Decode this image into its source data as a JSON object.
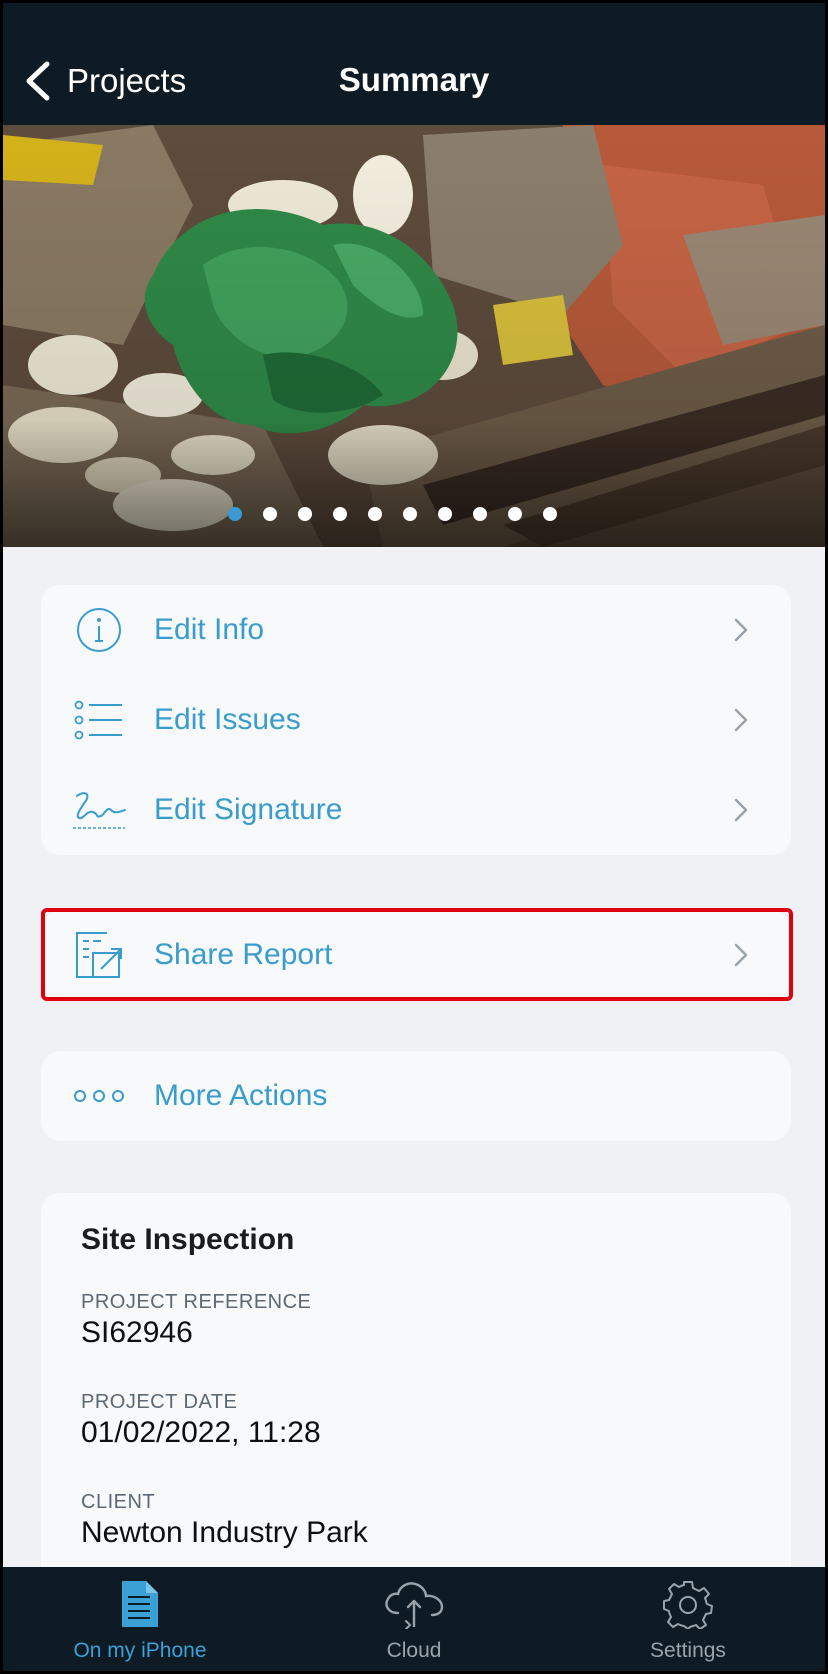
{
  "navbar": {
    "back_label": "Projects",
    "title": "Summary"
  },
  "carousel": {
    "photo_count": 10,
    "active_index": 0
  },
  "edit_menu": {
    "items": [
      {
        "label": "Edit Info",
        "icon": "info-icon"
      },
      {
        "label": "Edit Issues",
        "icon": "list-icon"
      },
      {
        "label": "Edit Signature",
        "icon": "signature-icon"
      }
    ]
  },
  "share": {
    "label": "Share Report",
    "icon": "share-report-icon"
  },
  "more": {
    "label": "More Actions",
    "icon": "more-dots-icon"
  },
  "project": {
    "title": "Site Inspection",
    "reference_label": "PROJECT REFERENCE",
    "reference_value": "SI62946",
    "date_label": "PROJECT DATE",
    "date_value": "01/02/2022, 11:28",
    "client_label": "CLIENT",
    "client_value": "Newton Industry Park"
  },
  "tabbar": {
    "tabs": [
      {
        "label": "On my iPhone",
        "icon": "document-icon",
        "active": true
      },
      {
        "label": "Cloud",
        "icon": "cloud-sync-icon",
        "active": false
      },
      {
        "label": "Settings",
        "icon": "gear-icon",
        "active": false
      }
    ]
  },
  "colors": {
    "accent": "#3a9ccc",
    "navbar_bg": "#0f1b24",
    "highlight_border": "#e0000d",
    "page_bg": "#eff1f5"
  }
}
